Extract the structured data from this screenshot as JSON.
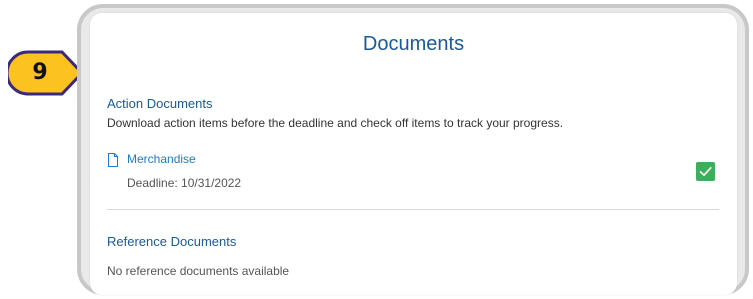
{
  "step_badge": {
    "number": "9",
    "color": "#fcc21f",
    "outline": "#3b2a7a"
  },
  "card": {
    "title": "Documents",
    "action_documents": {
      "heading": "Action Documents",
      "description": "Download action items before the deadline and check off items to track your progress.",
      "items": [
        {
          "name": "Merchandise",
          "deadline_label": "Deadline:",
          "deadline_value": "10/31/2022",
          "checked": true,
          "icon": "document-icon"
        }
      ]
    },
    "reference_documents": {
      "heading": "Reference Documents",
      "empty_text": "No reference documents available"
    }
  },
  "colors": {
    "heading_blue": "#1a5a96",
    "link_blue": "#1f7ac9",
    "check_green": "#3dae5b",
    "frame_gray": "#c8c8c8"
  }
}
